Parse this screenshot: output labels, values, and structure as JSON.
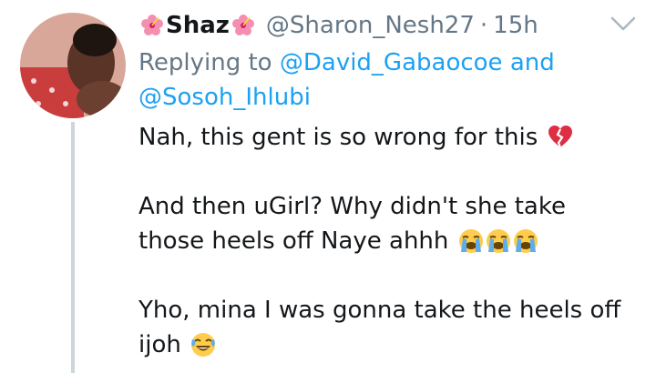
{
  "tweet": {
    "display_name": "Shaz",
    "handle": "@Sharon_Nesh27",
    "separator": "·",
    "time": "15h",
    "reply_prefix": "Replying to",
    "reply_mention_1": "@David_Gabaocoe",
    "reply_and": "and",
    "reply_mention_2": "@Sosoh_Ihlubi",
    "line1": "Nah, this gent is so wrong for this",
    "line2a": "And then uGirl? Why didn't she take",
    "line2b": "those heels off Naye ahhh",
    "line3a": "Yho, mina I was gonna take the heels off",
    "line3b": "ijoh"
  },
  "icons": {
    "name_decoration": "hibiscus-icon",
    "menu": "chevron-down-icon",
    "emoji_1": "broken-heart-emoji",
    "emoji_2": "loudly-crying-face-emoji",
    "emoji_3": "face-with-tears-of-joy-emoji"
  },
  "colors": {
    "link": "#1da1f2",
    "muted": "#657786",
    "text": "#14171a",
    "thread_line": "#ccd6dd"
  }
}
